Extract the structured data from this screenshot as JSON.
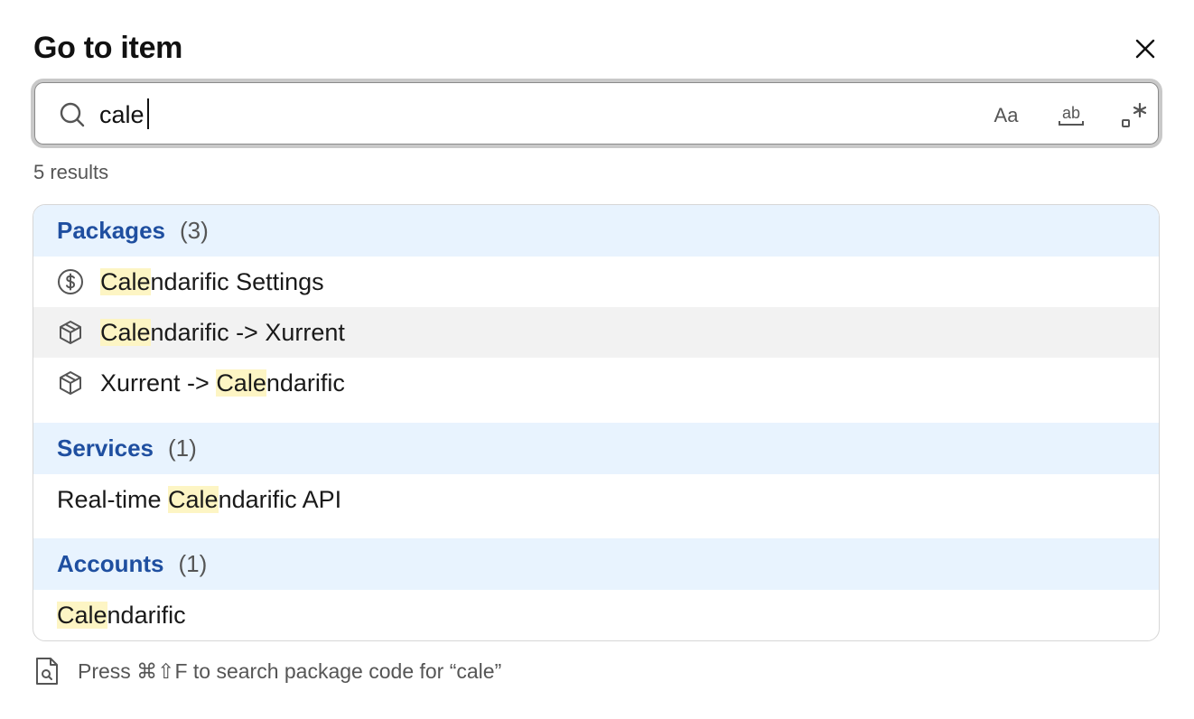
{
  "dialog": {
    "title": "Go to item",
    "close_icon": "close-icon"
  },
  "search": {
    "value": "cale",
    "icon": "search-icon",
    "options": [
      {
        "name": "match-case",
        "label": "Aa"
      },
      {
        "name": "whole-word",
        "label": "ab"
      },
      {
        "name": "regex",
        "label": ".*"
      }
    ]
  },
  "results": {
    "count_text": "5 results",
    "groups": [
      {
        "name": "Packages",
        "count": "(3)",
        "items": [
          {
            "pre": "",
            "match": "Cale",
            "post": "ndarific Settings",
            "icon": "dollar-circle-icon"
          },
          {
            "pre": "",
            "match": "Cale",
            "post": "ndarific -> Xurrent",
            "icon": "package-icon"
          },
          {
            "pre": "Xurrent -> ",
            "match": "Cale",
            "post": "ndarific",
            "icon": "package-icon"
          }
        ]
      },
      {
        "name": "Services",
        "count": "(1)",
        "items": [
          {
            "pre": "Real-time ",
            "match": "Cale",
            "post": "ndarific API"
          }
        ]
      },
      {
        "name": "Accounts",
        "count": "(1)",
        "items": [
          {
            "pre": "",
            "match": "Cale",
            "post": "ndarific"
          }
        ]
      }
    ]
  },
  "footer": {
    "text": "Press ⌘⇧F to search package code for “cale”",
    "icon": "file-search-icon"
  },
  "colors": {
    "group_header_bg": "#e8f3fe",
    "group_name": "#1f4fa0",
    "highlight": "#fdf5c4",
    "selected_row": "#f2f2f2"
  }
}
